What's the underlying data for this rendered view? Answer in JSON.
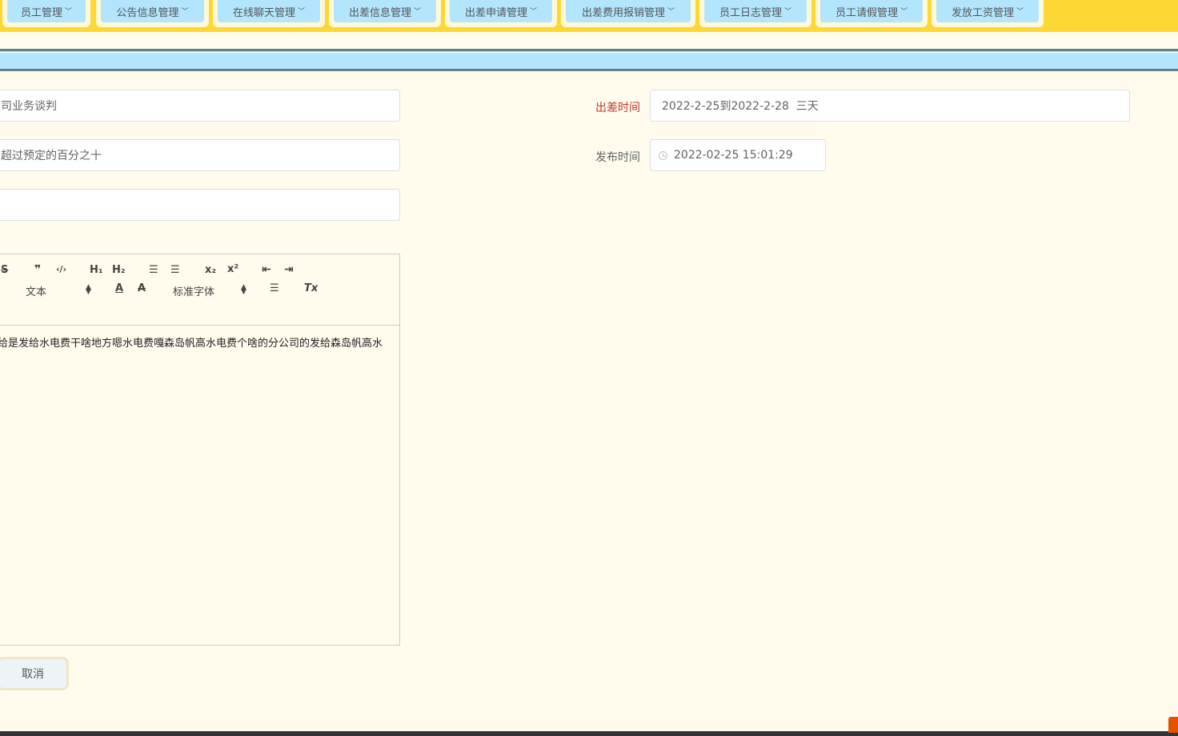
{
  "nav": {
    "items": [
      {
        "label": "员工管理"
      },
      {
        "label": "公告信息管理"
      },
      {
        "label": "在线聊天管理"
      },
      {
        "label": "出差信息管理"
      },
      {
        "label": "出差申请管理"
      },
      {
        "label": "出差费用报销管理"
      },
      {
        "label": "员工日志管理"
      },
      {
        "label": "员工请假管理"
      },
      {
        "label": "发放工资管理"
      }
    ]
  },
  "form": {
    "field1_value": "司业务谈判",
    "field2_value": "超过预定的百分之十",
    "field3_value": "",
    "trip_time_label": "出差时间",
    "trip_time_value": "2022-2-25到2022-2-28  三天",
    "publish_time_label": "发布时间",
    "publish_time_value": "2022-02-25 15:01:29"
  },
  "editor": {
    "toolbar": {
      "strike": "S",
      "quote": "❞",
      "code": "‹/›",
      "h1": "H₁",
      "h2": "H₂",
      "ordered_list": "☰",
      "bullet_list": "☰",
      "subscript": "x₂",
      "superscript": "x²",
      "outdent": "⇤",
      "indent": "⇥",
      "size_select": "文本",
      "font_color": "A",
      "bg_color": "A",
      "font_select": "标准字体",
      "align": "☰",
      "clean": "Tx"
    },
    "content": "给是发给水电费干啥地方嗯水电费嘎森岛帆高水电费个啥的分公司的发给森岛帆高水"
  },
  "buttons": {
    "cancel": "取消"
  },
  "colors": {
    "nav_bg": "#fdd835",
    "nav_item_bg": "#b3e5fc",
    "page_bg": "#fffcee",
    "required_label": "#c0392b"
  }
}
